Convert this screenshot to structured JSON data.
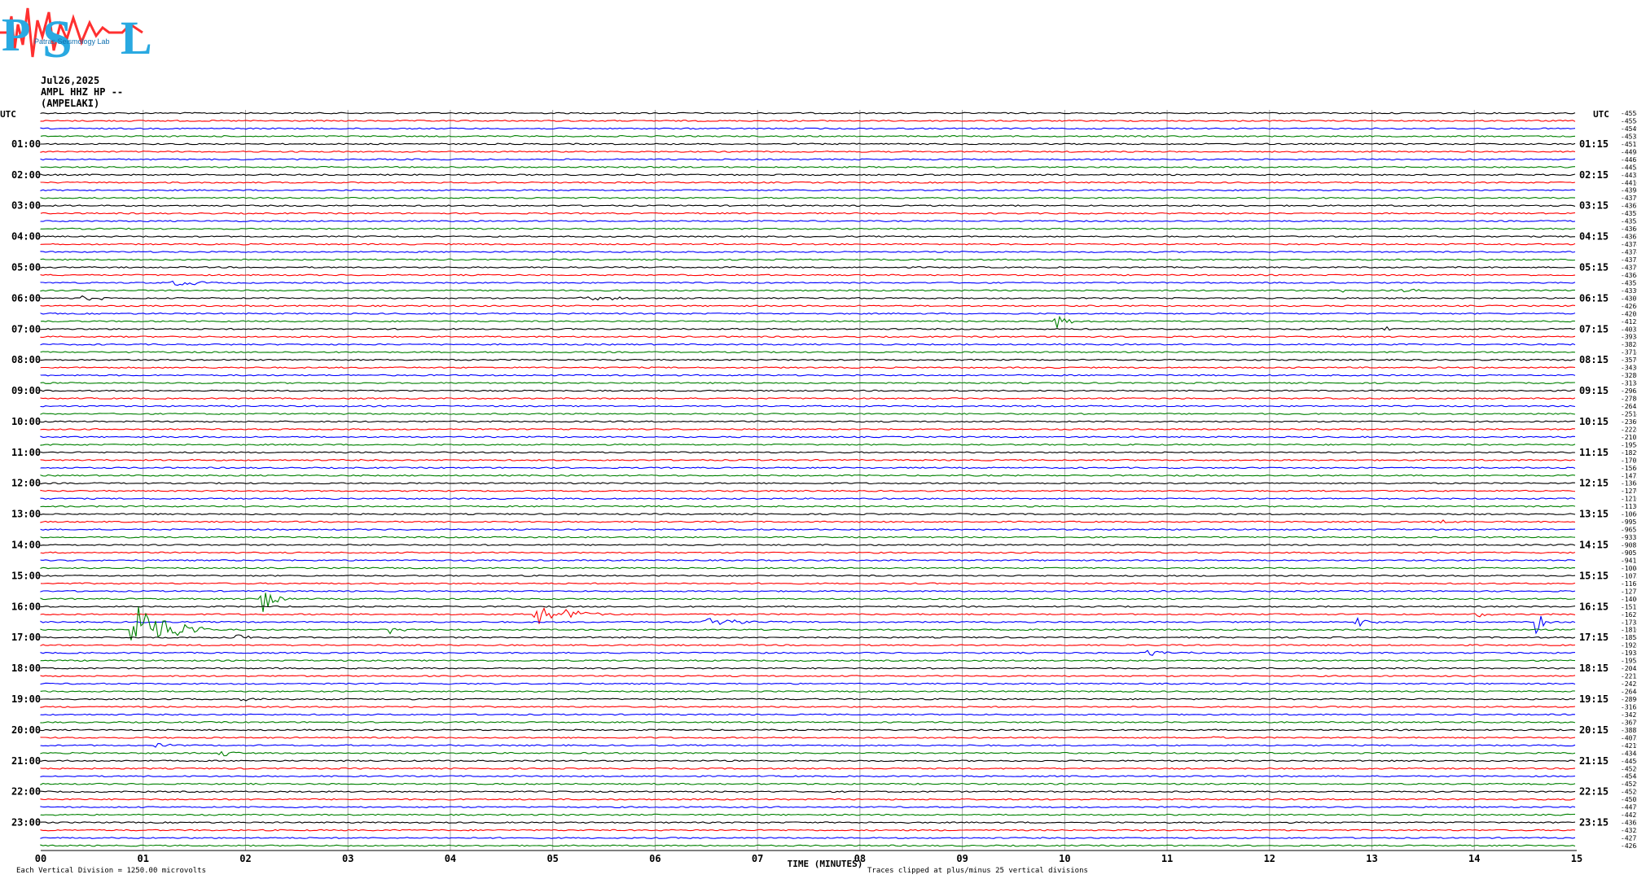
{
  "header": {
    "logo_text": "Patras Seismology Lab",
    "date": "Jul26,2025",
    "channel": "AMPL HHZ HP --",
    "station": "(AMPELAKI)"
  },
  "chart_data": {
    "type": "line",
    "title": "",
    "xlabel": "TIME (MINUTES)",
    "ylabel": "",
    "xlim": [
      0,
      15
    ],
    "x_ticks": [
      "00",
      "01",
      "02",
      "03",
      "04",
      "05",
      "06",
      "07",
      "08",
      "09",
      "10",
      "11",
      "12",
      "13",
      "14",
      "15"
    ],
    "left_axis_label": "UTC",
    "right_axis_label": "UTC",
    "left_times": [
      "01:00",
      "02:00",
      "03:00",
      "04:00",
      "05:00",
      "06:00",
      "07:00",
      "08:00",
      "09:00",
      "10:00",
      "11:00",
      "12:00",
      "13:00",
      "14:00",
      "15:00",
      "16:00",
      "17:00",
      "18:00",
      "19:00",
      "20:00",
      "21:00",
      "22:00",
      "23:00"
    ],
    "right_times": [
      "01:15",
      "02:15",
      "03:15",
      "04:15",
      "05:15",
      "06:15",
      "07:15",
      "08:15",
      "09:15",
      "10:15",
      "11:15",
      "12:15",
      "13:15",
      "14:15",
      "15:15",
      "16:15",
      "17:15",
      "18:15",
      "19:15",
      "20:15",
      "21:15",
      "22:15",
      "23:15"
    ],
    "trace_colors": [
      "#000000",
      "#ff0000",
      "#0000ff",
      "#008000"
    ],
    "trace_count": 96,
    "offsets": [
      "-4558",
      "-4554",
      "-4549",
      "-4532",
      "-4517",
      "-4498",
      "-4467",
      "-4453",
      "-4432",
      "-4416",
      "-4398",
      "-4379",
      "-4367",
      "-4357",
      "-4353",
      "-4360",
      "-4367",
      "-4374",
      "-4374",
      "-4373",
      "-4379",
      "-4364",
      "-4351",
      "-4339",
      "-4307",
      "-4266",
      "-4205",
      "-4122",
      "-4032",
      "-3934",
      "-3824",
      "-3714",
      "-3576",
      "-3430",
      "-3280",
      "-3134",
      "-2963",
      "-2786",
      "-2645",
      "-2514",
      "-2369",
      "-2224",
      "-2102",
      "-1954",
      "-1829",
      "-1702",
      "-1566",
      "-1475",
      "-1368",
      "-1276",
      "-1210",
      "-1130",
      "-1066",
      "-995",
      "-965",
      "-933",
      "-908",
      "-905",
      "-941",
      "-1004",
      "-1073",
      "-1167",
      "-1277",
      "-1406",
      "-1517",
      "-1627",
      "-1735",
      "-1816",
      "-1858",
      "-1924",
      "-1938",
      "-1953",
      "-2043",
      "-2212",
      "-2423",
      "-2644",
      "-2896",
      "-3162",
      "-3427",
      "-3679",
      "-3887",
      "-4073",
      "-4219",
      "-4348",
      "-4456",
      "-4526",
      "-4548",
      "-4529",
      "-4520",
      "-4502",
      "-4479",
      "-4427",
      "-4362",
      "-4323",
      "-4272",
      "-4268"
    ],
    "events": [
      {
        "trace": 22,
        "minute": 1.3,
        "amp": 6,
        "dur": 0.5
      },
      {
        "trace": 23,
        "minute": 12.7,
        "amp": 3,
        "dur": 0.3
      },
      {
        "trace": 23,
        "minute": 13.3,
        "amp": 3,
        "dur": 0.3
      },
      {
        "trace": 24,
        "minute": 0.4,
        "amp": 3,
        "dur": 0.6
      },
      {
        "trace": 24,
        "minute": 5.3,
        "amp": 3,
        "dur": 1.0
      },
      {
        "trace": 27,
        "minute": 9.9,
        "amp": 12,
        "dur": 0.25
      },
      {
        "trace": 28,
        "minute": 13.1,
        "amp": 4,
        "dur": 0.2
      },
      {
        "trace": 53,
        "minute": 13.6,
        "amp": 4,
        "dur": 0.4
      },
      {
        "trace": 63,
        "minute": 2.15,
        "amp": 30,
        "dur": 0.3
      },
      {
        "trace": 65,
        "minute": 4.85,
        "amp": 14,
        "dur": 0.9
      },
      {
        "trace": 65,
        "minute": 14.0,
        "amp": 5,
        "dur": 0.3
      },
      {
        "trace": 66,
        "minute": 6.5,
        "amp": 8,
        "dur": 0.8
      },
      {
        "trace": 66,
        "minute": 12.85,
        "amp": 7,
        "dur": 0.3
      },
      {
        "trace": 66,
        "minute": 14.6,
        "amp": 18,
        "dur": 0.2
      },
      {
        "trace": 67,
        "minute": 0.9,
        "amp": 45,
        "dur": 0.8
      },
      {
        "trace": 67,
        "minute": 3.4,
        "amp": 5,
        "dur": 0.3
      },
      {
        "trace": 68,
        "minute": 1.9,
        "amp": 4,
        "dur": 0.5
      },
      {
        "trace": 70,
        "minute": 10.8,
        "amp": 4,
        "dur": 0.6
      },
      {
        "trace": 76,
        "minute": 1.9,
        "amp": 4,
        "dur": 0.4
      },
      {
        "trace": 81,
        "minute": 11.4,
        "amp": 3,
        "dur": 0.3
      },
      {
        "trace": 83,
        "minute": 1.75,
        "amp": 5,
        "dur": 0.3
      },
      {
        "trace": 82,
        "minute": 1.1,
        "amp": 3,
        "dur": 0.4
      }
    ]
  },
  "footer": {
    "scale_note": "Each Vertical Division = 1250.00 microvolts",
    "clip_note": "Traces clipped at plus/minus 25 vertical divisions"
  }
}
